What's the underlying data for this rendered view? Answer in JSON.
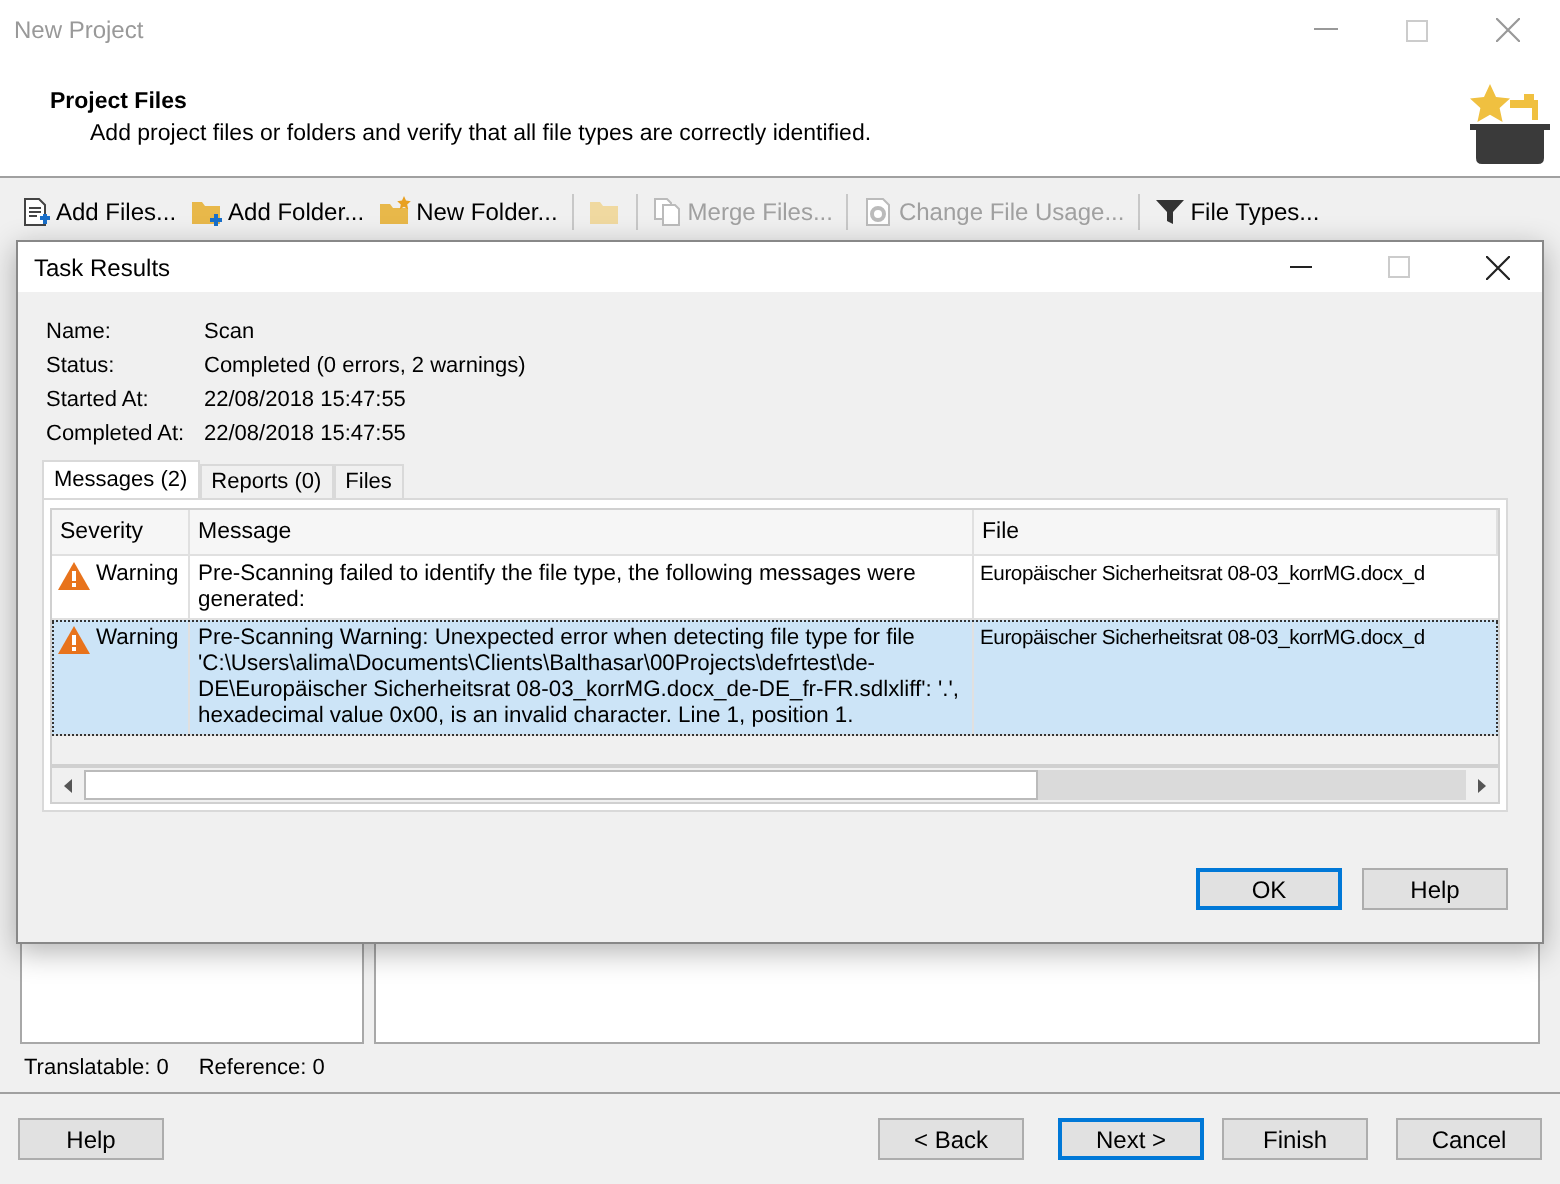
{
  "window": {
    "title": "New Project"
  },
  "header": {
    "title": "Project Files",
    "description": "Add project files or folders and verify that all file types are correctly identified."
  },
  "toolbar": [
    {
      "kind": "add-files",
      "label": "Add Files...",
      "disabled": false
    },
    {
      "kind": "add-folder",
      "label": "Add Folder...",
      "disabled": false
    },
    {
      "kind": "new-folder",
      "label": "New Folder...",
      "disabled": false
    },
    {
      "kind": "open-folder",
      "disabled": true
    },
    {
      "kind": "merge",
      "label": "Merge Files...",
      "disabled": true
    },
    {
      "kind": "change-usage",
      "label": "Change File Usage...",
      "disabled": true
    },
    {
      "kind": "file-types",
      "label": "File Types...",
      "disabled": false
    }
  ],
  "counts": [
    "Translatable: 0",
    "Reference: 0"
  ],
  "buttons": [
    {
      "label": "Help",
      "default": false
    },
    {
      "label": "< Back",
      "default": false
    },
    {
      "label": "Next >",
      "default": true
    },
    {
      "label": "Finish",
      "default": false
    },
    {
      "label": "Cancel",
      "default": false
    }
  ],
  "dialog": {
    "title": "Task Results",
    "info": [
      {
        "label": "Name:",
        "value": "Scan"
      },
      {
        "label": "Status:",
        "value": "Completed (0 errors, 2 warnings)"
      },
      {
        "label": "Started At:",
        "value": "22/08/2018 15:47:55"
      },
      {
        "label": "Completed At:",
        "value": "22/08/2018 15:47:55"
      }
    ],
    "tabs": [
      {
        "label": "Messages (2)",
        "selected": true
      },
      {
        "label": "Reports (0)",
        "selected": false
      },
      {
        "label": "Files",
        "selected": false
      }
    ],
    "table": {
      "columns": [
        "Severity",
        "Message",
        "File"
      ],
      "rows": [
        {
          "severity": "Warning",
          "message": "Pre-Scanning failed to identify the file type, the following messages were generated:",
          "file": "Europäischer Sicherheitsrat 08-03_korrMG.docx_d",
          "selected": false
        },
        {
          "severity": "Warning",
          "message": "Pre-Scanning Warning: Unexpected error when detecting file type for file 'C:\\Users\\alima\\Documents\\Clients\\Balthasar\\00Projects\\defrtest\\de-DE\\Europäischer Sicherheitsrat 08-03_korrMG.docx_de-DE_fr-FR.sdlxliff': '.', hexadecimal value 0x00, is an invalid character. Line 1, position 1.",
          "file": "Europäischer Sicherheitsrat 08-03_korrMG.docx_d",
          "selected": true
        }
      ]
    },
    "buttons": [
      {
        "label": "OK",
        "default": true
      },
      {
        "label": "Help",
        "default": false
      }
    ]
  }
}
